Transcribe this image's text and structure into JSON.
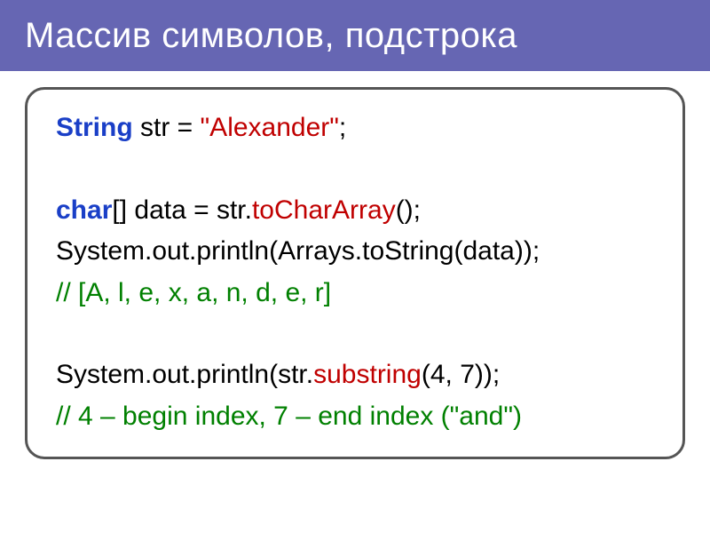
{
  "header": {
    "title": "Массив символов, подстрока"
  },
  "code": {
    "line1": {
      "kw": "String",
      "mid": " str = ",
      "literal": "\"Alexander\"",
      "end": ";"
    },
    "line2": {
      "kw": "char",
      "mid1": "[] data = str.",
      "method": "toCharArray",
      "end": "();"
    },
    "line3": {
      "text": "System.out.println(Arrays.toString(data));"
    },
    "line4": {
      "comment": "// [A, l, e, x, a, n, d, e, r]"
    },
    "line5": {
      "pre": "System.out.println(str.",
      "method": "substring",
      "post": "(4, 7));"
    },
    "line6": {
      "comment": "// 4 – begin index, 7 – end index (\"and\")"
    }
  }
}
